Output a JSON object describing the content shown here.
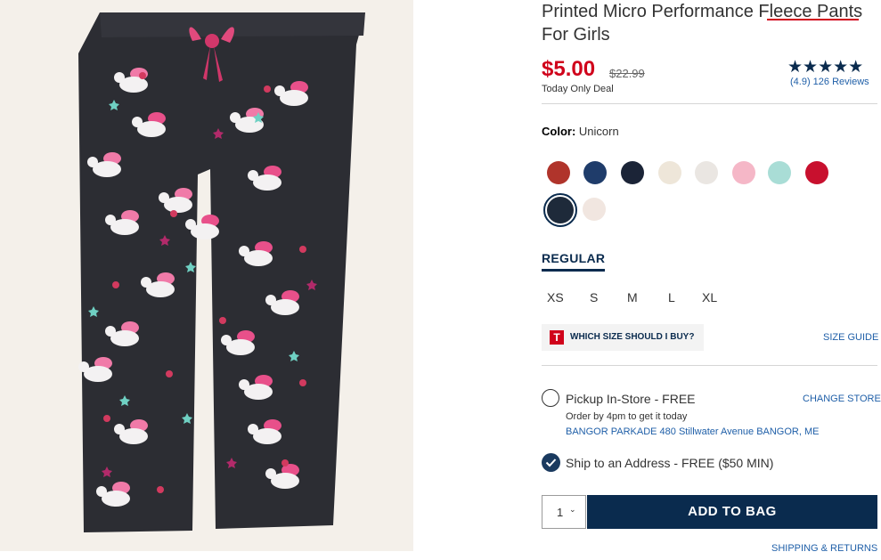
{
  "product": {
    "title": "Printed Micro Performance Fleece Pants For Girls",
    "price": "$5.00",
    "original_price": "$22.99",
    "deal_text": "Today Only Deal",
    "stars": "★★★★★",
    "reviews": "(4.9) 126 Reviews",
    "image_name": "product-image"
  },
  "color": {
    "label": "Color:",
    "value": "Unicorn",
    "swatches": [
      {
        "name": "fair-isle",
        "color": "#b0342b",
        "selected": false
      },
      {
        "name": "plaid",
        "color": "#1f3c6a",
        "selected": false
      },
      {
        "name": "navy-print",
        "color": "#1b2437",
        "selected": false
      },
      {
        "name": "cream-dots",
        "color": "#eee6d9",
        "selected": false
      },
      {
        "name": "snowflake",
        "color": "#eae6e2",
        "selected": false
      },
      {
        "name": "pink-dog",
        "color": "#f5b7c7",
        "selected": false
      },
      {
        "name": "mint-dots",
        "color": "#a9ddd6",
        "selected": false
      },
      {
        "name": "candy-cane",
        "color": "#c8102e",
        "selected": false
      },
      {
        "name": "unicorn",
        "color": "#1e2a3a",
        "selected": true
      },
      {
        "name": "confetti-stars",
        "color": "#f1e6e0",
        "selected": false
      }
    ]
  },
  "size_type": "REGULAR",
  "sizes": [
    "XS",
    "S",
    "M",
    "L",
    "XL"
  ],
  "fit": {
    "icon_letter": "T",
    "question": "WHICH SIZE SHOULD I BUY?",
    "size_guide": "SIZE GUIDE"
  },
  "pickup": {
    "label": "Pickup In-Store - FREE",
    "change_store": "CHANGE STORE",
    "note": "Order by 4pm to get it today",
    "store": "BANGOR PARKADE 480 Stillwater Avenue  BANGOR, ME"
  },
  "ship": {
    "label": "Ship to an Address - FREE ($50 MIN)"
  },
  "cart": {
    "quantity": "1",
    "add_button": "ADD TO BAG",
    "shipping_link": "SHIPPING & RETURNS"
  },
  "colors": {
    "sale_red": "#d0021b",
    "navy": "#0a2b4e",
    "link_blue": "#1f5fa8"
  }
}
